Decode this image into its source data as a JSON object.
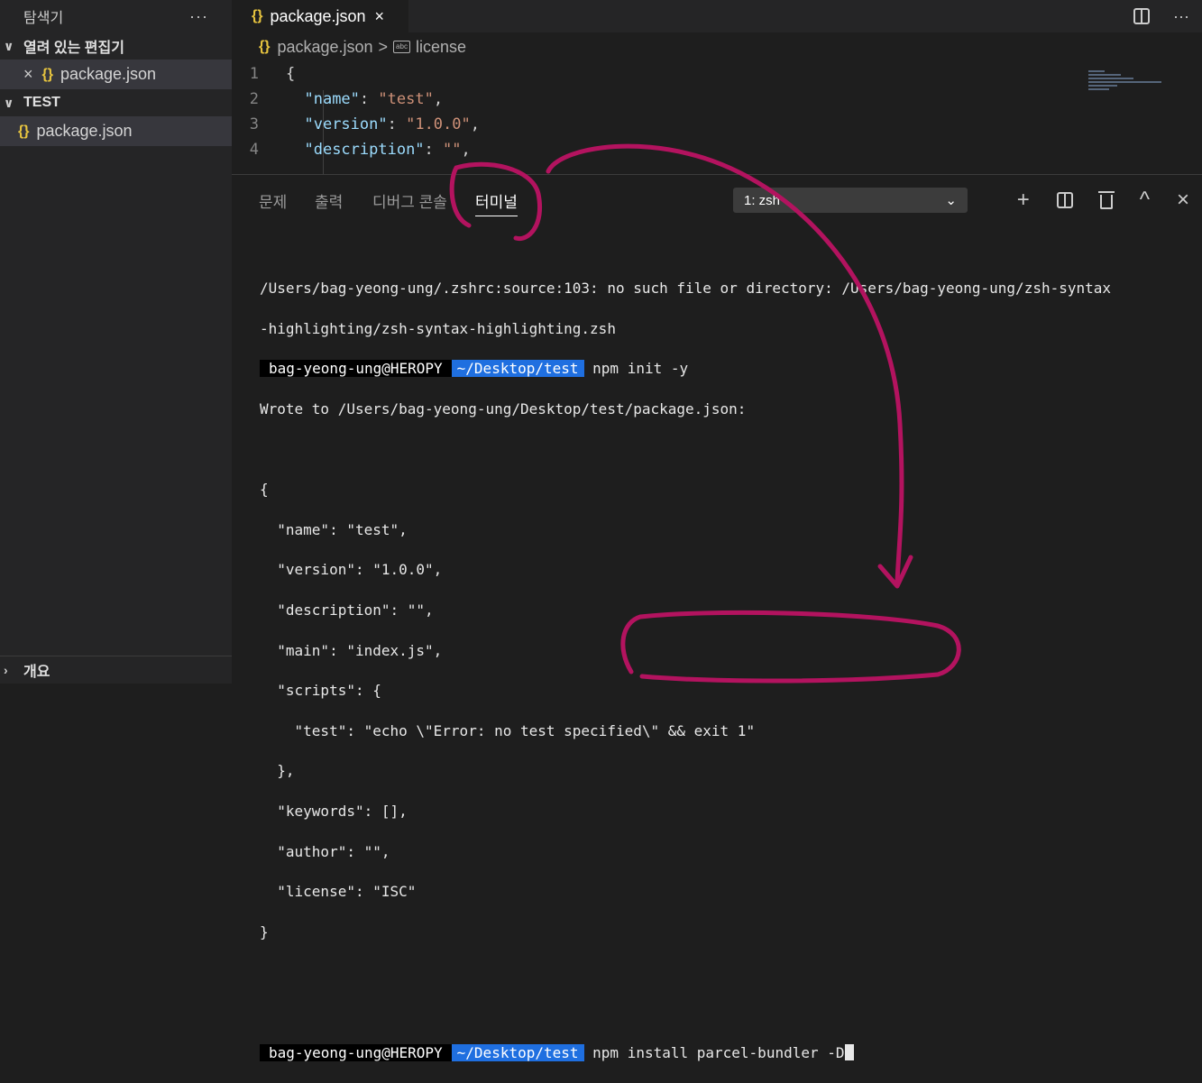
{
  "sidebar": {
    "title": "탐색기",
    "more": "···",
    "open_editors_label": "열려 있는 편집기",
    "open_editors_file": "package.json",
    "folder_label": "TEST",
    "folder_file": "package.json",
    "outline_label": "개요"
  },
  "editor": {
    "tab_label": "package.json",
    "tab_close": "×",
    "more": "···",
    "breadcrumb": {
      "file": "package.json",
      "sep": ">",
      "symbol": "license",
      "symbol_icon": "abc"
    },
    "lines": [
      {
        "num": "1",
        "text": "{"
      },
      {
        "num": "2",
        "key": "\"name\"",
        "sep": ": ",
        "value": "\"test\"",
        "tail": ","
      },
      {
        "num": "3",
        "key": "\"version\"",
        "sep": ": ",
        "value": "\"1.0.0\"",
        "tail": ","
      },
      {
        "num": "4",
        "key": "\"description\"",
        "sep": ": ",
        "value": "\"\"",
        "tail": ","
      }
    ]
  },
  "panel": {
    "tabs": [
      "문제",
      "출력",
      "디버그 콘솔",
      "터미널"
    ],
    "terminal_select": "1: zsh",
    "plus": "+",
    "caret_up": "^",
    "close": "×"
  },
  "terminal": {
    "line1": "/Users/bag-yeong-ung/.zshrc:source:103: no such file or directory: /Users/bag-yeong-ung/zsh-syntax",
    "line2": "-highlighting/zsh-syntax-highlighting.zsh",
    "prompt_user": "bag-yeong-ung@HEROPY",
    "prompt_sep": "",
    "prompt_path": "~/Desktop/test",
    "prompt_end": "",
    "cmd1": "npm init -y",
    "wrote": "Wrote to /Users/bag-yeong-ung/Desktop/test/package.json:",
    "json_lines": [
      "{",
      "  \"name\": \"test\",",
      "  \"version\": \"1.0.0\",",
      "  \"description\": \"\",",
      "  \"main\": \"index.js\",",
      "  \"scripts\": {",
      "    \"test\": \"echo \\\"Error: no test specified\\\" && exit 1\"",
      "  },",
      "  \"keywords\": [],",
      "  \"author\": \"\",",
      "  \"license\": \"ISC\"",
      "}"
    ],
    "cmd2": "npm install parcel-bundler -D"
  },
  "colors": {
    "annotation": "#b3135f",
    "prompt_path_bg": "#1f6fe0",
    "json_key": "#9cdcfe",
    "json_string": "#ce9178",
    "brace": "#e8c53f"
  }
}
